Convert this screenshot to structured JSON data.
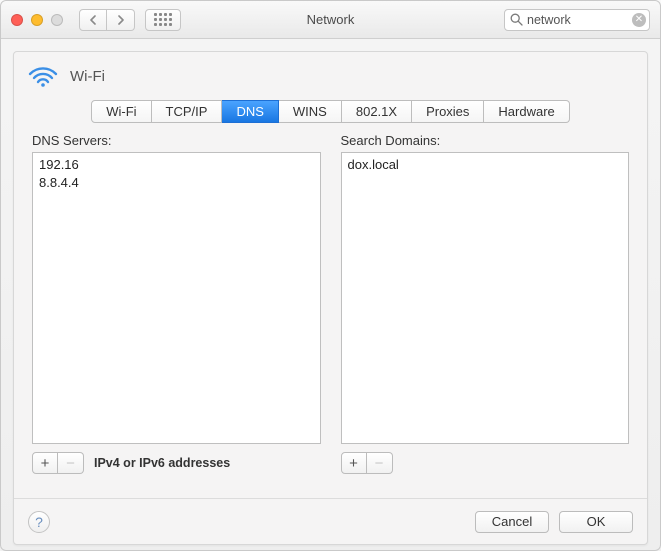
{
  "titlebar": {
    "title": "Network",
    "search_value": "network"
  },
  "connection": {
    "name": "Wi-Fi"
  },
  "tabs": [
    {
      "label": "Wi-Fi",
      "active": false
    },
    {
      "label": "TCP/IP",
      "active": false
    },
    {
      "label": "DNS",
      "active": true
    },
    {
      "label": "WINS",
      "active": false
    },
    {
      "label": "802.1X",
      "active": false
    },
    {
      "label": "Proxies",
      "active": false
    },
    {
      "label": "Hardware",
      "active": false
    }
  ],
  "dns": {
    "label": "DNS Servers:",
    "servers": [
      "192.16",
      "8.8.4.4"
    ],
    "hint": "IPv4 or IPv6 addresses"
  },
  "search_domains": {
    "label": "Search Domains:",
    "domains": [
      "dox.local"
    ]
  },
  "buttons": {
    "cancel": "Cancel",
    "ok": "OK"
  }
}
